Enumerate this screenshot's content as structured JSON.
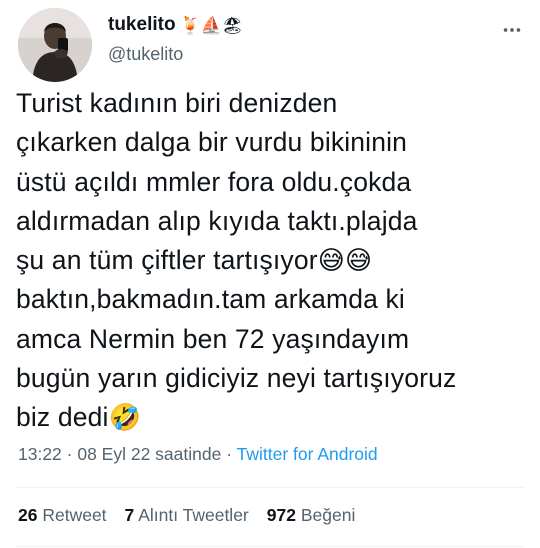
{
  "user": {
    "display_name": "tukelito",
    "name_emojis": "🍹⛵🏖",
    "handle": "@tukelito"
  },
  "tweet": {
    "lines": [
      "Turist kadının biri denizden",
      "çıkarken dalga bir vurdu bikininin",
      "üstü açıldı mmler fora oldu.çokda",
      "aldırmadan alıp kıyıda taktı.plajda",
      "şu an tüm çiftler tartışıyor",
      "baktın,bakmadın.tam arkamda ki",
      "amca Nermin ben 72 yaşındayım",
      "bugün yarın gidiciyiz neyi tartışıyoruz",
      "biz  dedi"
    ],
    "line5_emojis": "😅😅",
    "line9_emoji": "🤣"
  },
  "meta": {
    "time": "13:22",
    "separator": " · ",
    "date": "08 Eyl 22 saatinde",
    "source": "Twitter for Android"
  },
  "stats": {
    "retweets_count": "26",
    "retweets_label": "Retweet",
    "quotes_count": "7",
    "quotes_label": "Alıntı Tweetler",
    "likes_count": "972",
    "likes_label": "Beğeni"
  }
}
